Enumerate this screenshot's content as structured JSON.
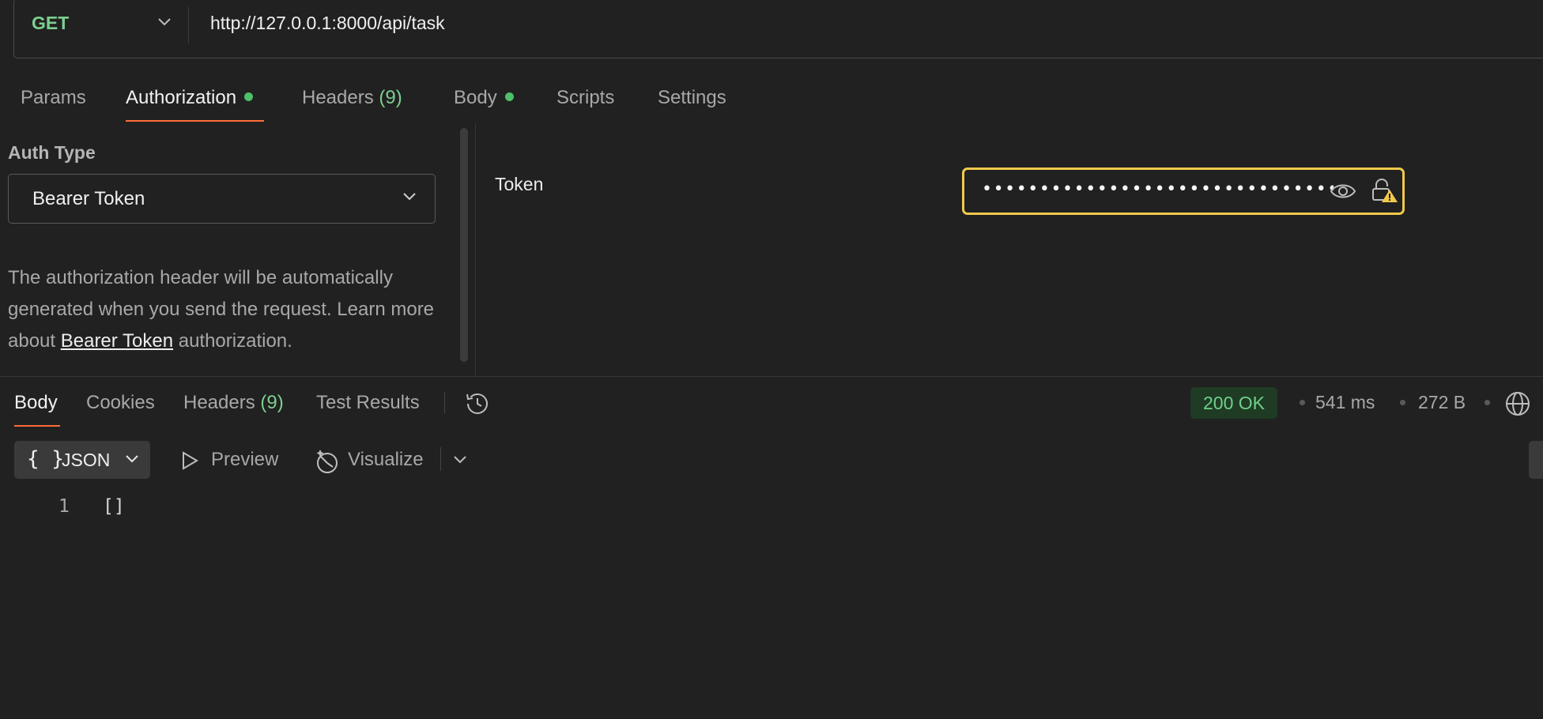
{
  "request": {
    "method": "GET",
    "url": "http://127.0.0.1:8000/api/task"
  },
  "request_tabs": [
    {
      "label": "Params",
      "count": "",
      "active": false,
      "dot": false
    },
    {
      "label": "Authorization",
      "count": "",
      "active": true,
      "dot": true
    },
    {
      "label": "Headers",
      "count": "(9)",
      "active": false,
      "dot": false
    },
    {
      "label": "Body",
      "count": "",
      "active": false,
      "dot": true
    },
    {
      "label": "Scripts",
      "count": "",
      "active": false,
      "dot": false
    },
    {
      "label": "Settings",
      "count": "",
      "active": false,
      "dot": false
    }
  ],
  "auth": {
    "type_label": "Auth Type",
    "type_value": "Bearer Token",
    "description_before": "The authorization header will be automatically generated when you send the request. Learn more about ",
    "description_link": "Bearer Token",
    "description_after": " authorization.",
    "token_label": "Token",
    "token_value": "••••••••••••••••••••••••••••••••••"
  },
  "response_tabs": [
    {
      "label": "Body",
      "count": "",
      "active": true
    },
    {
      "label": "Cookies",
      "count": "",
      "active": false
    },
    {
      "label": "Headers",
      "count": "(9)",
      "active": false
    },
    {
      "label": "Test Results",
      "count": "",
      "active": false
    }
  ],
  "response_meta": {
    "status": "200 OK",
    "time": "541 ms",
    "size": "272 B"
  },
  "format_toolbar": {
    "json_braces": "{ }",
    "json_label": "JSON",
    "preview_label": "Preview",
    "visualize_label": "Visualize"
  },
  "code": {
    "line_number": "1",
    "content": "[]"
  },
  "colors": {
    "background": "#212121",
    "accent_orange": "#ff6c37",
    "method_green": "#7ccf8f",
    "token_border": "#f2c94c",
    "status_green": "#6fd08b"
  },
  "icons": [
    "chevron-down-icon",
    "eye-icon",
    "lock-warning-icon",
    "history-icon",
    "globe-icon",
    "braces-icon",
    "play-icon",
    "visualize-icon"
  ]
}
